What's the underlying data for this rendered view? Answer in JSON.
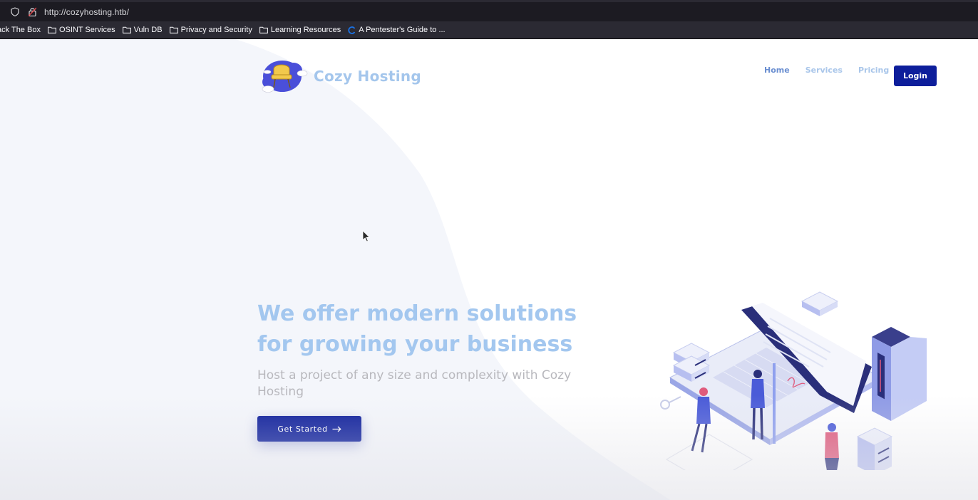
{
  "browser": {
    "url": "http://cozyhosting.htb/",
    "bookmarks": [
      {
        "label": "ack The Box",
        "icon": "none"
      },
      {
        "label": "OSINT Services",
        "icon": "folder-icon"
      },
      {
        "label": "Vuln DB",
        "icon": "folder-icon"
      },
      {
        "label": "Privacy and Security",
        "icon": "folder-icon"
      },
      {
        "label": "Learning Resources",
        "icon": "folder-icon"
      },
      {
        "label": "A Pentester's Guide to ...",
        "icon": "loading-icon"
      }
    ]
  },
  "site": {
    "brand": "Cozy Hosting",
    "nav": {
      "home": "Home",
      "services": "Services",
      "pricing": "Pricing",
      "login": "Login"
    },
    "hero": {
      "title": "We offer modern solutions for growing your business",
      "subtitle": "Host a project of any size and complexity with Cozy Hosting",
      "cta": "Get Started",
      "cta_icon": "arrow-right-icon"
    }
  },
  "colors": {
    "primary": "#0d1e9b",
    "hero_title": "#a3c7ef",
    "nav_active": "#6b8fd1",
    "nav_inactive": "#a9c6ea",
    "subtitle": "#b8b8bd"
  }
}
